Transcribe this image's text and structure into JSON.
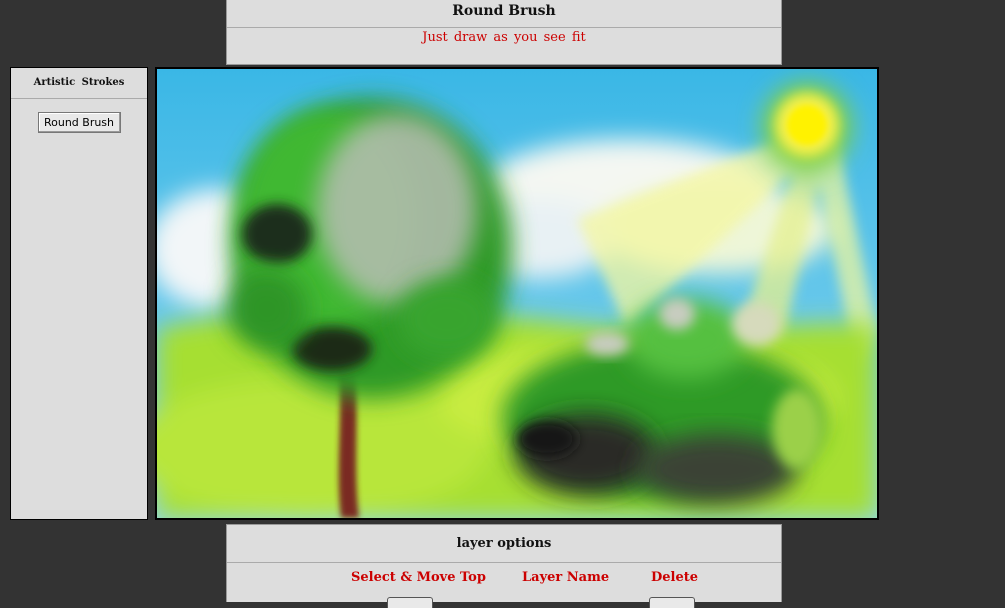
{
  "header": {
    "title": "Round Brush",
    "subtitle": "Just draw as you see fit"
  },
  "sidebar": {
    "title": "Artistic Strokes",
    "button_label": "Round Brush"
  },
  "canvas": {
    "description_icon": "painting-canvas"
  },
  "layers": {
    "title": "layer options",
    "columns": [
      "Select & Move Top",
      "Layer Name",
      "Delete"
    ]
  },
  "colors": {
    "background": "#333333",
    "panel": "#dddddd",
    "accent_red": "#cc0000"
  }
}
